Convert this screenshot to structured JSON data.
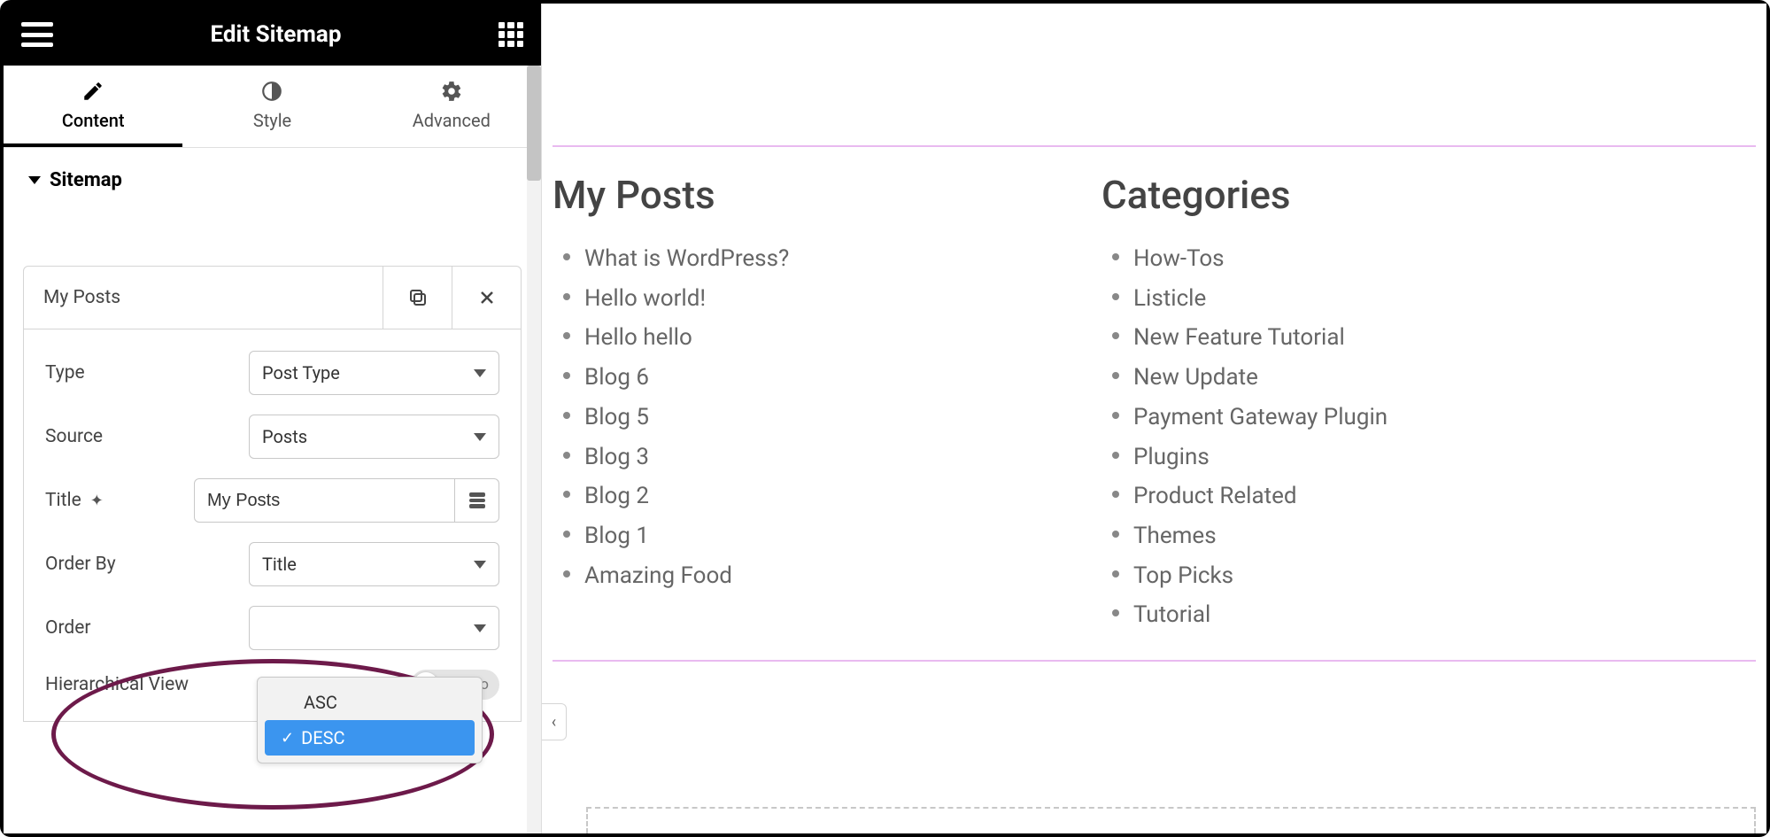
{
  "header": {
    "title": "Edit Sitemap"
  },
  "tabs": {
    "content": "Content",
    "style": "Style",
    "advanced": "Advanced"
  },
  "section": {
    "title": "Sitemap"
  },
  "item": {
    "title": "My Posts"
  },
  "controls": {
    "type": {
      "label": "Type",
      "value": "Post Type"
    },
    "source": {
      "label": "Source",
      "value": "Posts"
    },
    "title": {
      "label": "Title",
      "value": "My Posts"
    },
    "order_by": {
      "label": "Order By",
      "value": "Title"
    },
    "order": {
      "label": "Order",
      "options": {
        "asc": "ASC",
        "desc": "DESC"
      }
    },
    "hierarchical": {
      "label": "Hierarchical View",
      "value": "No"
    }
  },
  "preview": {
    "posts": {
      "heading": "My Posts",
      "items": [
        "What is WordPress?",
        "Hello world!",
        "Hello hello",
        "Blog 6",
        "Blog 5",
        "Blog 3",
        "Blog 2",
        "Blog 1",
        "Amazing Food"
      ]
    },
    "categories": {
      "heading": "Categories",
      "items": [
        "How-Tos",
        "Listicle",
        "New Feature Tutorial",
        "New Update",
        "Payment Gateway Plugin",
        "Plugins",
        "Product Related",
        "Themes",
        "Top Picks",
        "Tutorial"
      ]
    }
  },
  "collapse": "‹"
}
